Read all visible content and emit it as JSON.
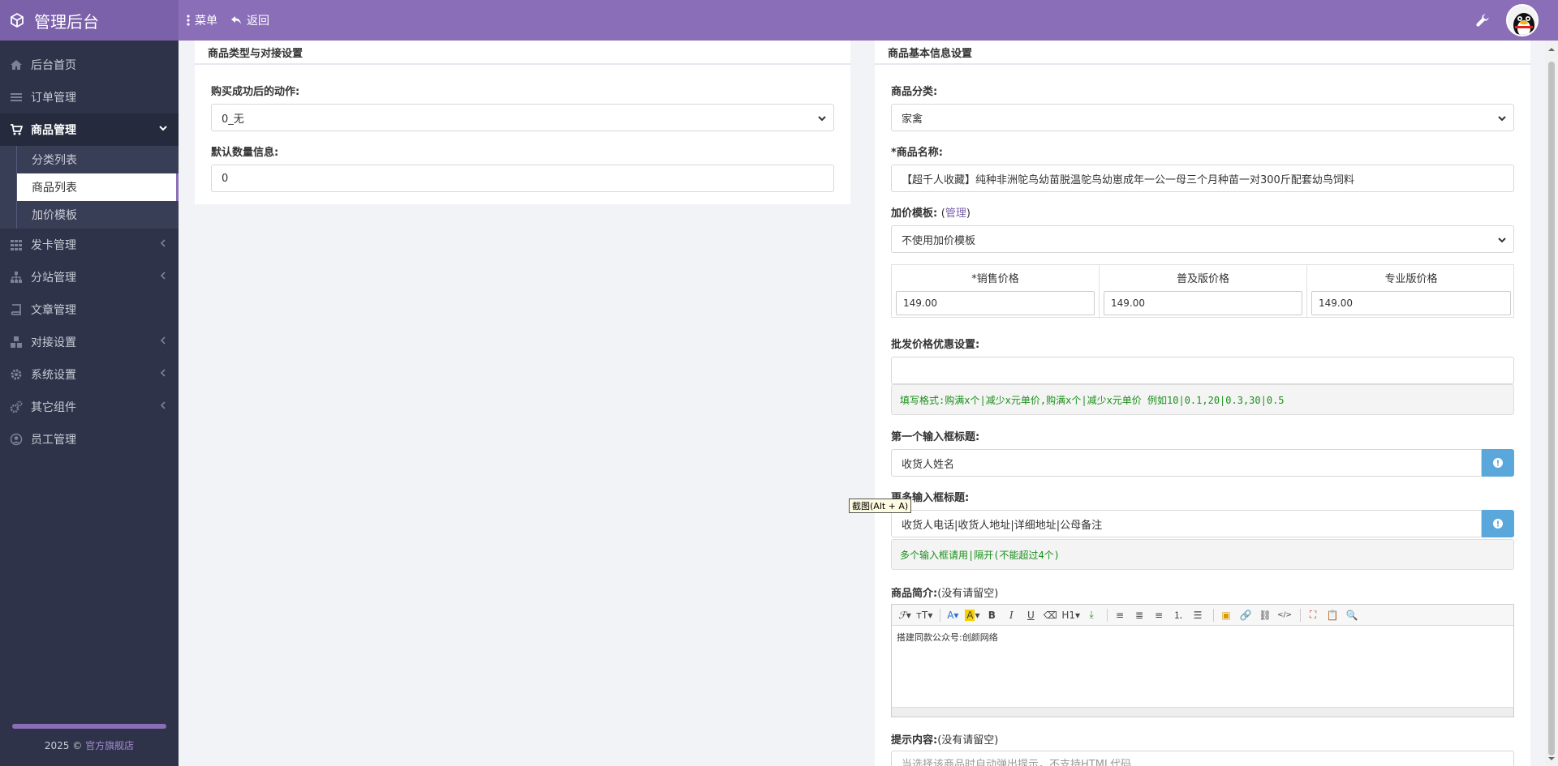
{
  "app": {
    "title": "管理后台"
  },
  "topnav": {
    "menu": "菜单",
    "back": "返回"
  },
  "sidebar": {
    "items": [
      {
        "label": "后台首页"
      },
      {
        "label": "订单管理"
      },
      {
        "label": "商品管理"
      },
      {
        "label": "发卡管理"
      },
      {
        "label": "分站管理"
      },
      {
        "label": "文章管理"
      },
      {
        "label": "对接设置"
      },
      {
        "label": "系统设置"
      },
      {
        "label": "其它组件"
      },
      {
        "label": "员工管理"
      }
    ],
    "sub_items": [
      {
        "label": "分类列表"
      },
      {
        "label": "商品列表"
      },
      {
        "label": "加价模板"
      }
    ],
    "footer_year": "2025 ©",
    "footer_link": "官方旗舰店"
  },
  "left_panel": {
    "title": "商品类型与对接设置",
    "action_label": "购买成功后的动作:",
    "action_value": "0_无",
    "qty_label": "默认数量信息:",
    "qty_value": "0"
  },
  "right_panel": {
    "title": "商品基本信息设置",
    "category_label": "商品分类:",
    "category_value": "家禽",
    "name_label": "*商品名称:",
    "name_value": "【超千人收藏】纯种非洲鸵鸟幼苗脱温鸵鸟幼崽成年一公一母三个月种苗一对300斤配套幼鸟饲料",
    "template_label": "加价模板:",
    "template_paren_open": "(",
    "template_link": "管理",
    "template_paren_close": ")",
    "template_value": "不使用加价模板",
    "price_headers": [
      "*销售价格",
      "普及版价格",
      "专业版价格"
    ],
    "price_values": [
      "149.00",
      "149.00",
      "149.00"
    ],
    "wholesale_label": "批发价格优惠设置:",
    "wholesale_hint": "填写格式:购满x个|减少x元单价,购满x个|减少x元单价  例如10|0.1,20|0.3,30|0.5",
    "first_input_label": "第一个输入框标题:",
    "first_input_value": "收货人姓名",
    "more_input_label": "更多输入框标题:",
    "more_input_value": "收货人电话|收货人地址|详细地址|公母备注",
    "more_input_hint": "多个输入框请用|隔开(不能超过4个)",
    "intro_label": "商品简介:",
    "intro_note": "(没有请留空)",
    "intro_content": "搭建同款公众号:创颜网络",
    "tip_label": "提示内容:",
    "tip_note": "(没有请留空)",
    "tip_placeholder": "当选择该商品时自动弹出提示，不支持HTML代码"
  },
  "tooltip": "截图(Alt + A)"
}
